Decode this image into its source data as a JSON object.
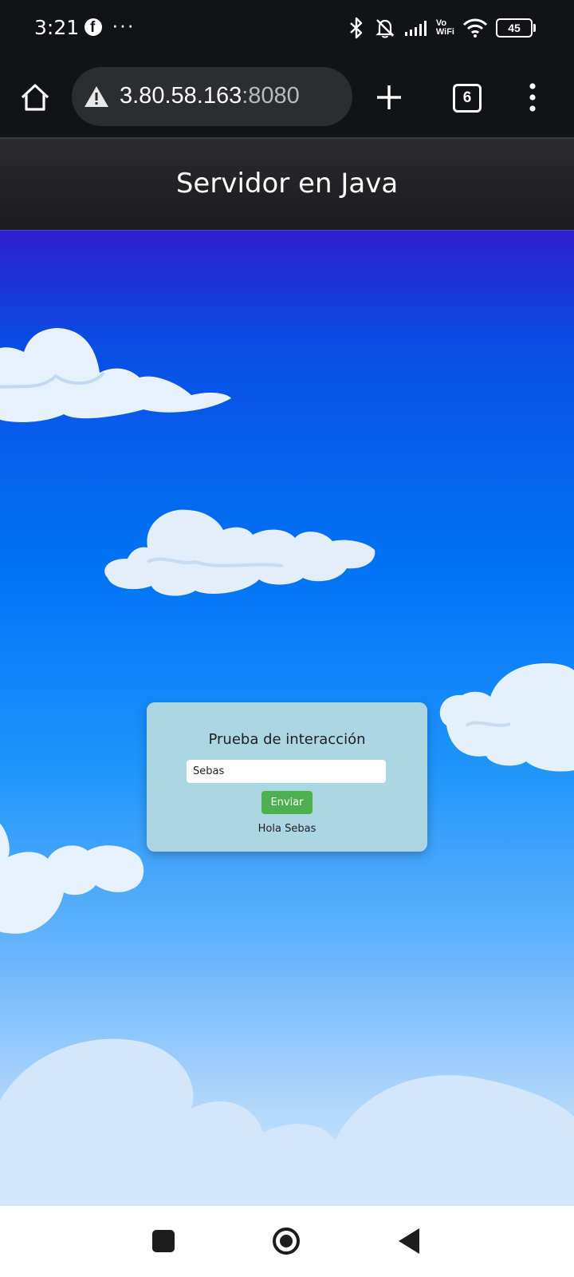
{
  "status_bar": {
    "time": "3:21",
    "dots": "···",
    "battery": "45",
    "vowifi_top": "Vo",
    "vowifi_bottom": "WiFi"
  },
  "browser": {
    "url_host": "3.80.58.163",
    "url_port": ":8080",
    "tab_count": "6"
  },
  "page": {
    "title": "Servidor en Java"
  },
  "card": {
    "title": "Prueba de interacción",
    "input_value": "Sebas",
    "button_label": "Enviar",
    "response": "Hola Sebas"
  }
}
